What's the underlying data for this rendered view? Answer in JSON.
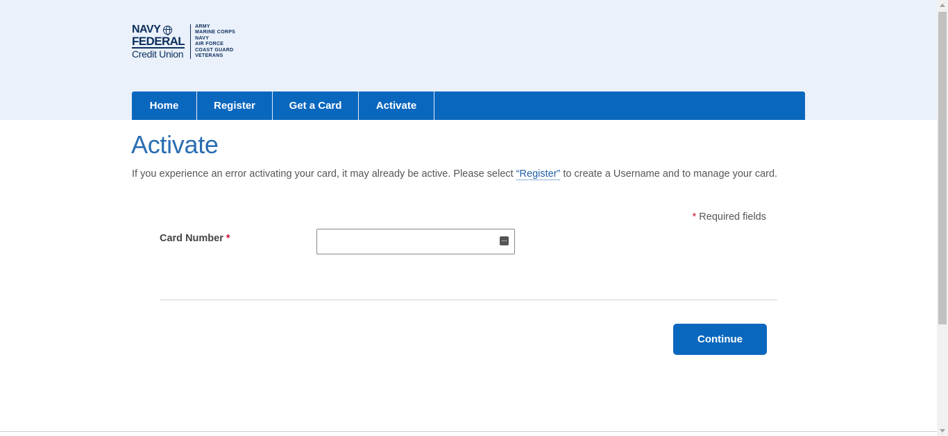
{
  "logo": {
    "line1": "NAVY",
    "line2": "FEDERAL",
    "line3": "Credit Union",
    "branches": [
      "ARMY",
      "MARINE CORPS",
      "NAVY",
      "AIR FORCE",
      "COAST GUARD",
      "VETERANS"
    ]
  },
  "nav": {
    "items": [
      {
        "label": "Home"
      },
      {
        "label": "Register"
      },
      {
        "label": "Get a Card"
      },
      {
        "label": "Activate"
      }
    ]
  },
  "page": {
    "title": "Activate",
    "intro_before": "If you experience an error activating your card, it may already be active. Please select ",
    "intro_link": "“Register”",
    "intro_after": " to create a Username and to manage your card.",
    "required_star": "*",
    "required_text": " Required fields"
  },
  "form": {
    "card_number_label": "Card Number",
    "required_marker": "*",
    "card_number_value": "",
    "continue_label": "Continue"
  },
  "colors": {
    "primary": "#0a67be",
    "header_bg": "#eaf1fa",
    "title": "#2a6db2",
    "required": "#c8102e"
  },
  "icons": {
    "field_icon": "keyboard-icon"
  }
}
